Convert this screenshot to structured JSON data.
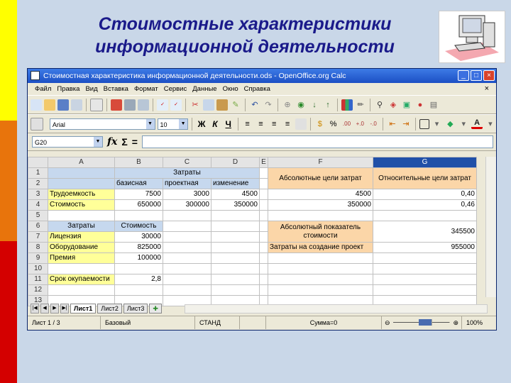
{
  "slide_title_line1": "Стоимостные характеристики",
  "slide_title_line2": "информационной деятельности",
  "window_title": "Стоимостная характеристика информационной деятельности.ods - OpenOffice.org Calc",
  "menu": [
    "Файл",
    "Правка",
    "Вид",
    "Вставка",
    "Формат",
    "Сервис",
    "Данные",
    "Окно",
    "Справка"
  ],
  "font_name": "Arial",
  "font_size": "10",
  "fmt": {
    "bold": "Ж",
    "italic": "К",
    "underline": "Ч"
  },
  "cell_ref": "G20",
  "columns": [
    "",
    "A",
    "B",
    "C",
    "D",
    "E",
    "F",
    "G"
  ],
  "cells": {
    "r1": {
      "bc": "Затраты",
      "f": "Абсолютные цели затрат",
      "g": "Относительные цели затрат"
    },
    "r2": {
      "b": "базисная",
      "c": "проектная",
      "d": "изменение"
    },
    "r3": {
      "a": "Трудоемкость",
      "b": "7500",
      "c": "3000",
      "d": "4500",
      "f": "4500",
      "g": "0,40"
    },
    "r4": {
      "a": "Стоимость",
      "b": "650000",
      "c": "300000",
      "d": "350000",
      "f": "350000",
      "g": "0,46"
    },
    "r6": {
      "a": "Затраты",
      "b": "Стоимость",
      "f": "Абсолютный показатель стоимости"
    },
    "r7": {
      "a": "Лицензия",
      "b": "30000",
      "g": "345500"
    },
    "r8": {
      "a": "Оборудование",
      "b": "825000",
      "f": "Затраты на создание проект",
      "g": "955000"
    },
    "r9": {
      "a": "Премия",
      "b": "100000"
    },
    "r11": {
      "a": "Срок окупаемости",
      "b": "2,8"
    }
  },
  "sheet_tabs": [
    "Лист1",
    "Лист2",
    "Лист3"
  ],
  "status": {
    "sheet": "Лист 1 / 3",
    "style": "Базовый",
    "mode": "СТАНД",
    "sum": "Сумма=0",
    "zoom": "100%"
  }
}
